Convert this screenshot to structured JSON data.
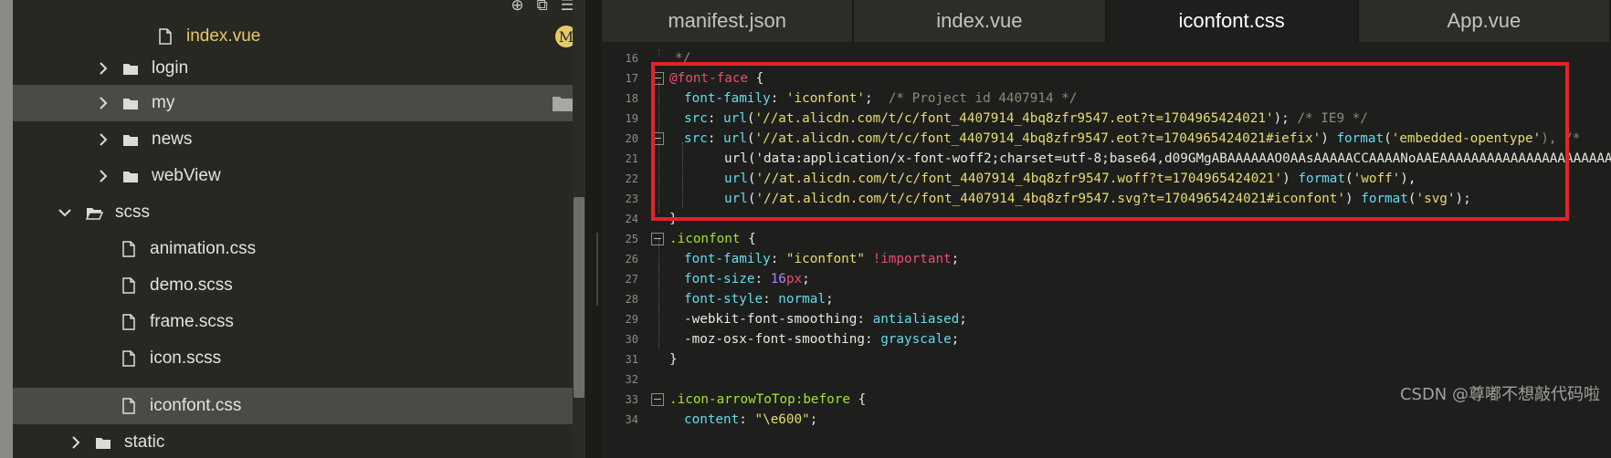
{
  "explorer": {
    "items": [
      {
        "label": "index.vue",
        "kind": "file",
        "state": "modified",
        "badge": "M"
      },
      {
        "label": "login",
        "kind": "folder",
        "state": "collapsed"
      },
      {
        "label": "my",
        "kind": "folder",
        "state": "collapsed"
      },
      {
        "label": "news",
        "kind": "folder",
        "state": "collapsed"
      },
      {
        "label": "webView",
        "kind": "folder",
        "state": "collapsed"
      },
      {
        "label": "scss",
        "kind": "folder",
        "state": "expanded"
      },
      {
        "label": "animation.css",
        "kind": "file"
      },
      {
        "label": "demo.scss",
        "kind": "file"
      },
      {
        "label": "frame.scss",
        "kind": "file"
      },
      {
        "label": "icon.scss",
        "kind": "file"
      },
      {
        "label": "iconfont.css",
        "kind": "file",
        "state": "selected"
      },
      {
        "label": "static",
        "kind": "folder",
        "state": "collapsed"
      }
    ]
  },
  "tabs": [
    {
      "label": "manifest.json"
    },
    {
      "label": "index.vue"
    },
    {
      "label": "iconfont.css",
      "active": true
    },
    {
      "label": "App.vue"
    }
  ],
  "editor": {
    "line_numbers": [
      "16",
      "17",
      "18",
      "19",
      "20",
      "21",
      "22",
      "23",
      "24",
      "25",
      "26",
      "27",
      "28",
      "29",
      "30",
      "31",
      "32",
      "33",
      "34"
    ],
    "lines": {
      "l16": "*/",
      "l17a": "@font-face",
      "l17b": " {",
      "l18a": "font-family",
      "l18b": ": ",
      "l18c": "'iconfont'",
      "l18d": ";  ",
      "l18e": "/* Project id 4407914 */",
      "l19a": "src",
      "l19b": ": ",
      "l19c": "url",
      "l19d": "(",
      "l19e": "'//at.alicdn.com/t/c/font_4407914_4bq8zfr9547.eot?t=1704965424021'",
      "l19f": "); ",
      "l19g": "/* IE9 */",
      "l20a": "src",
      "l20b": ": ",
      "l20c": "url",
      "l20d": "(",
      "l20e": "'//at.alicdn.com/t/c/font_4407914_4bq8zfr9547.eot?t=1704965424021#iefix'",
      "l20f": ") ",
      "l20g": "format",
      "l20h": "(",
      "l20i": "'embedded-opentype'",
      "l20j": "), /*",
      "l21": "url('data:application/x-font-woff2;charset=utf-8;base64,d09GMgABAAAAAAO0AAsAAAAACCAAAANoAAEAAAAAAAAAAAAAAAAAAAAAAAAA",
      "l22a": "url",
      "l22b": "(",
      "l22c": "'//at.alicdn.com/t/c/font_4407914_4bq8zfr9547.woff?t=1704965424021'",
      "l22d": ") ",
      "l22e": "format",
      "l22f": "(",
      "l22g": "'woff'",
      "l22h": "),",
      "l23a": "url",
      "l23b": "(",
      "l23c": "'//at.alicdn.com/t/c/font_4407914_4bq8zfr9547.svg?t=1704965424021#iconfont'",
      "l23d": ") ",
      "l23e": "format",
      "l23f": "(",
      "l23g": "'svg'",
      "l23h": ");",
      "l24": "}",
      "l25a": ".iconfont",
      "l25b": " {",
      "l26a": "font-family",
      "l26b": ": ",
      "l26c": "\"iconfont\"",
      "l26d": " ",
      "l26e": "!important",
      "l26f": ";",
      "l27a": "font-size",
      "l27b": ": ",
      "l27c": "16",
      "l27d": "px",
      "l27e": ";",
      "l28a": "font-style",
      "l28b": ": ",
      "l28c": "normal",
      "l28d": ";",
      "l29a": "-webkit-font-smoothing",
      "l29b": ": ",
      "l29c": "antialiased",
      "l29d": ";",
      "l30a": "-moz-osx-font-smoothing",
      "l30b": ": ",
      "l30c": "grayscale",
      "l30d": ";",
      "l31": "}",
      "l32": "",
      "l33a": ".icon-arrowToTop:before",
      "l33b": " {",
      "l34a": "content",
      "l34b": ": ",
      "l34c": "\"\\e600\"",
      "l34d": ";"
    }
  },
  "watermark": "CSDN @尊嘟不想敲代码啦",
  "colors": {
    "highlight": "#e3222a",
    "modified": "#e6c96a",
    "selector": "#a6e22e",
    "at_rule": "#f0487a",
    "string": "#e6db74"
  }
}
